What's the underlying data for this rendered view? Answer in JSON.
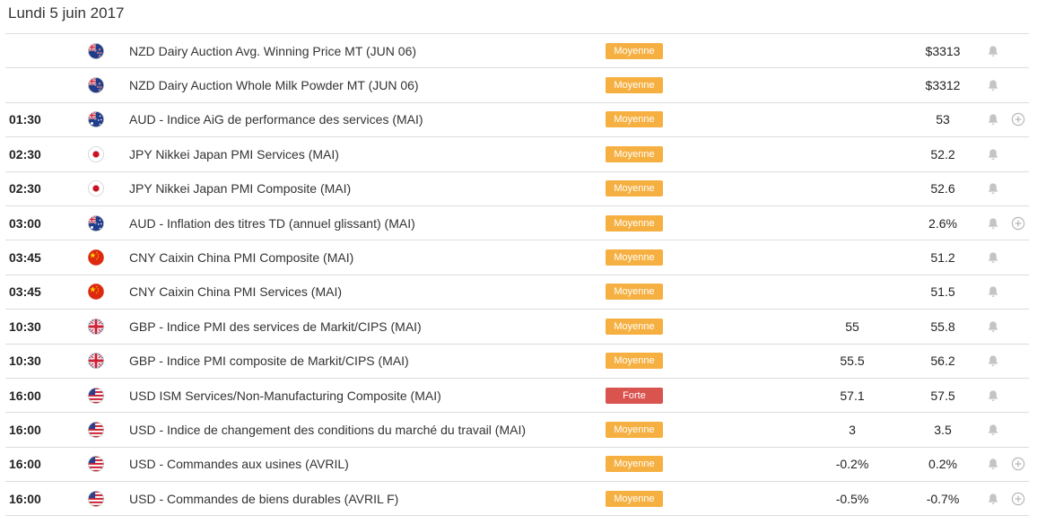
{
  "date": "Lundi 5 juin 2017",
  "colors": {
    "moyenne": "#f5b041",
    "forte": "#d9534f",
    "icon": "#c4c4c4"
  },
  "rows": [
    {
      "time": "",
      "flag": "nz-flag-icon",
      "event": "NZD Dairy Auction Avg. Winning Price MT (JUN 06)",
      "impact": "Moyenne",
      "actual": "",
      "forecast": "$3313",
      "plus": false
    },
    {
      "time": "",
      "flag": "nz-flag-icon",
      "event": "NZD Dairy Auction Whole Milk Powder MT (JUN 06)",
      "impact": "Moyenne",
      "actual": "",
      "forecast": "$3312",
      "plus": false
    },
    {
      "time": "01:30",
      "flag": "au-flag-icon",
      "event": "AUD - Indice AiG de performance des services (MAI)",
      "impact": "Moyenne",
      "actual": "",
      "forecast": "53",
      "plus": true
    },
    {
      "time": "02:30",
      "flag": "jp-flag-icon",
      "event": "JPY Nikkei Japan PMI Services (MAI)",
      "impact": "Moyenne",
      "actual": "",
      "forecast": "52.2",
      "plus": false
    },
    {
      "time": "02:30",
      "flag": "jp-flag-icon",
      "event": "JPY Nikkei Japan PMI Composite (MAI)",
      "impact": "Moyenne",
      "actual": "",
      "forecast": "52.6",
      "plus": false
    },
    {
      "time": "03:00",
      "flag": "au-flag-icon",
      "event": "AUD - Inflation des titres TD (annuel glissant) (MAI)",
      "impact": "Moyenne",
      "actual": "",
      "forecast": "2.6%",
      "plus": true
    },
    {
      "time": "03:45",
      "flag": "cn-flag-icon",
      "event": "CNY Caixin China PMI Composite (MAI)",
      "impact": "Moyenne",
      "actual": "",
      "forecast": "51.2",
      "plus": false
    },
    {
      "time": "03:45",
      "flag": "cn-flag-icon",
      "event": "CNY Caixin China PMI Services (MAI)",
      "impact": "Moyenne",
      "actual": "",
      "forecast": "51.5",
      "plus": false
    },
    {
      "time": "10:30",
      "flag": "gb-flag-icon",
      "event": "GBP - Indice PMI des services de Markit/CIPS (MAI)",
      "impact": "Moyenne",
      "actual": "55",
      "forecast": "55.8",
      "plus": false
    },
    {
      "time": "10:30",
      "flag": "gb-flag-icon",
      "event": "GBP - Indice PMI composite de Markit/CIPS (MAI)",
      "impact": "Moyenne",
      "actual": "55.5",
      "forecast": "56.2",
      "plus": false
    },
    {
      "time": "16:00",
      "flag": "us-flag-icon",
      "event": "USD ISM Services/Non-Manufacturing Composite (MAI)",
      "impact": "Forte",
      "actual": "57.1",
      "forecast": "57.5",
      "plus": false
    },
    {
      "time": "16:00",
      "flag": "us-flag-icon",
      "event": "USD - Indice de changement des conditions du marché du travail (MAI)",
      "impact": "Moyenne",
      "actual": "3",
      "forecast": "3.5",
      "plus": false
    },
    {
      "time": "16:00",
      "flag": "us-flag-icon",
      "event": "USD - Commandes aux usines (AVRIL)",
      "impact": "Moyenne",
      "actual": "-0.2%",
      "forecast": "0.2%",
      "plus": true
    },
    {
      "time": "16:00",
      "flag": "us-flag-icon",
      "event": "USD - Commandes de biens durables (AVRIL F)",
      "impact": "Moyenne",
      "actual": "-0.5%",
      "forecast": "-0.7%",
      "plus": true
    }
  ]
}
